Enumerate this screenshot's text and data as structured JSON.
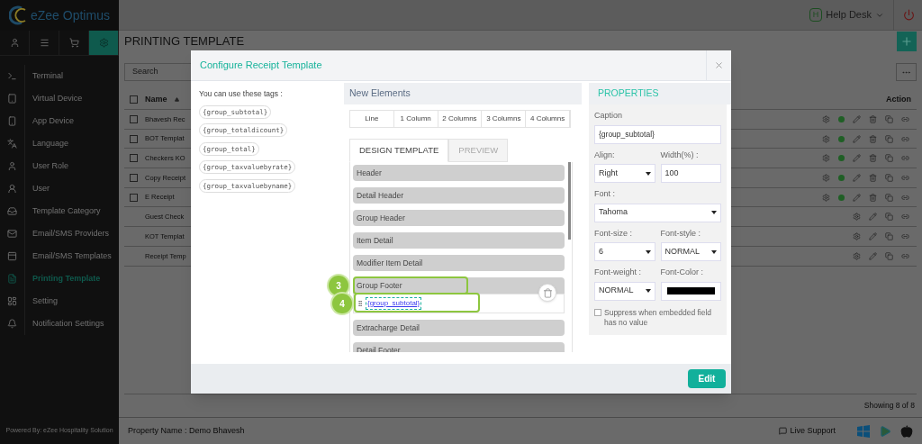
{
  "app": {
    "logo": "eZee Optimus",
    "help_badge": "H",
    "help_label": "Help Desk"
  },
  "sidebar": {
    "tabs": [
      {
        "selected": false
      },
      {
        "selected": false
      },
      {
        "selected": false
      },
      {
        "selected": true
      }
    ],
    "items": [
      {
        "label": "Terminal",
        "selected": false
      },
      {
        "label": "Virtual Device",
        "selected": false
      },
      {
        "label": "App Device",
        "selected": false
      },
      {
        "label": "Language",
        "selected": false
      },
      {
        "label": "User Role",
        "selected": false
      },
      {
        "label": "User",
        "selected": false
      },
      {
        "label": "Template Category",
        "selected": false
      },
      {
        "label": "Email/SMS Providers",
        "selected": false
      },
      {
        "label": "Email/SMS Templates",
        "selected": false
      },
      {
        "label": "Printing Template",
        "selected": true
      },
      {
        "label": "Setting",
        "selected": false
      },
      {
        "label": "Notification Settings",
        "selected": false
      }
    ],
    "footer": "Powered By: eZee Hospitality Solution"
  },
  "page": {
    "title": "PRINTING TEMPLATE",
    "search_placeholder": "Search",
    "columns": [
      "Name",
      "Action"
    ],
    "select_all_checked": false,
    "rows": [
      {
        "name": "Bhavesh Rec",
        "kind": "custom",
        "checked": false
      },
      {
        "name": "BOT Templat",
        "kind": "custom",
        "checked": false
      },
      {
        "name": "Checkers KO",
        "kind": "custom",
        "checked": false
      },
      {
        "name": "Copy Receipt",
        "kind": "custom",
        "checked": false
      },
      {
        "name": "E Receipt",
        "kind": "custom",
        "checked": false
      },
      {
        "name": "Guest Check",
        "kind": "system"
      },
      {
        "name": "KOT Templat",
        "kind": "system"
      },
      {
        "name": "Receipt Temp",
        "kind": "system"
      }
    ],
    "showing": "Showing 8 of 8"
  },
  "status_bar": {
    "property": "Property Name : Demo Bhavesh",
    "support": "Live Support"
  },
  "modal": {
    "title": "Configure Receipt Template",
    "tags_intro": "You can use these tags :",
    "tags": [
      "{group_subtotal}",
      "{group_totaldicount}",
      "{group_total}",
      "{group_taxvaluebyrate}",
      "{group_taxvaluebyname}"
    ],
    "new_elements": {
      "title": "New Elements",
      "items": [
        "Line",
        "1 Column",
        "2 Columns",
        "3 Columns",
        "4 Columns"
      ]
    },
    "tabs": [
      {
        "label": "DESIGN TEMPLATE",
        "selected": true
      },
      {
        "label": "PREVIEW",
        "selected": false
      }
    ],
    "sections": [
      {
        "label": "Header",
        "expanded": false
      },
      {
        "label": "Detail Header",
        "expanded": false
      },
      {
        "label": "Group Header",
        "expanded": false
      },
      {
        "label": "Item Detail",
        "expanded": false
      },
      {
        "label": "Modifier Item Detail",
        "expanded": false
      },
      {
        "label": "Group Footer",
        "expanded": true,
        "callout": "3",
        "fields": [
          {
            "text": "{group_subtotal}",
            "selected": true,
            "callout": "4"
          }
        ]
      },
      {
        "label": "Extracharge Detail",
        "expanded": false
      },
      {
        "label": "Detail Footer",
        "expanded": false
      }
    ],
    "properties": {
      "title": "PROPERTIES",
      "caption": {
        "label": "Caption",
        "value": "{group_subtotal}"
      },
      "align": {
        "label": "Align:",
        "value": "Right"
      },
      "width": {
        "label": "Width(%) :",
        "value": "100"
      },
      "font": {
        "label": "Font :",
        "value": "Tahoma"
      },
      "font_size": {
        "label": "Font-size :",
        "value": "6"
      },
      "font_style": {
        "label": "Font-style :",
        "value": "NORMAL"
      },
      "font_weight": {
        "label": "Font-weight :",
        "value": "NORMAL"
      },
      "font_color": {
        "label": "Font-Color :",
        "color": "#000000"
      },
      "suppress": {
        "label": "Suppress when embedded field has no value",
        "checked": false
      }
    },
    "button": "Edit"
  }
}
